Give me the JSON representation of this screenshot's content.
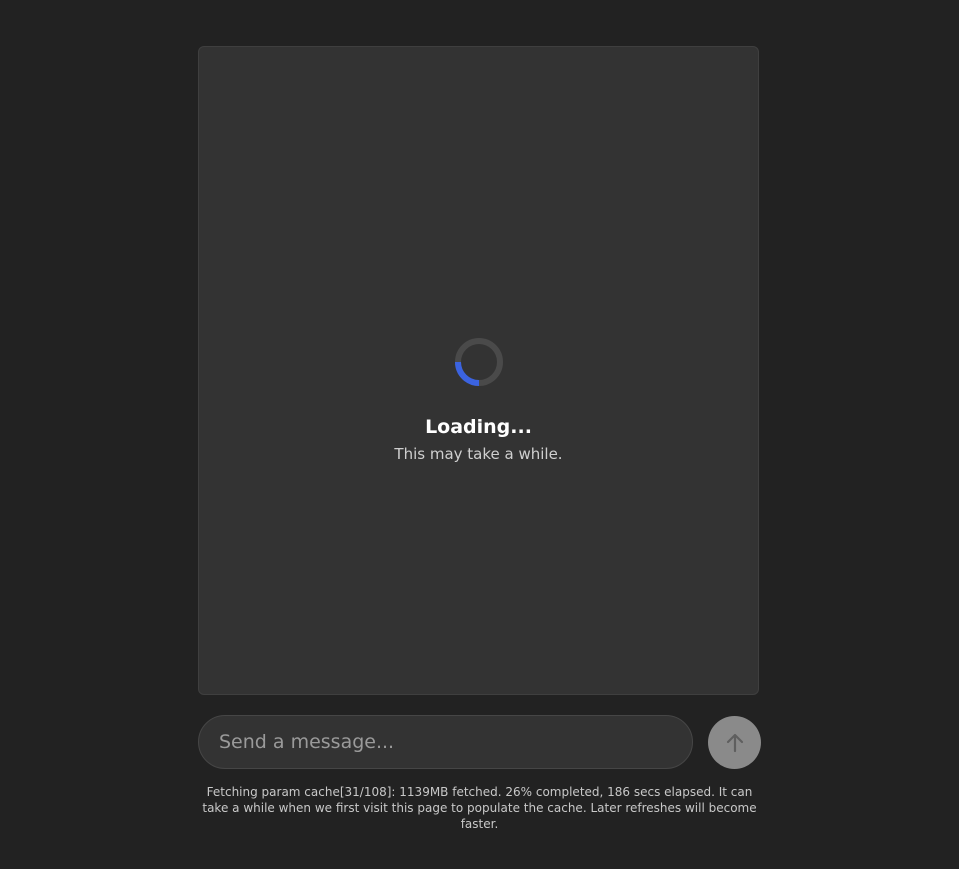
{
  "loading": {
    "title": "Loading...",
    "subtitle": "This may take a while.",
    "spinner_accent": "#3b63e0",
    "spinner_track": "#4a4a4a"
  },
  "composer": {
    "placeholder": "Send a message...",
    "value": "",
    "send_icon": "arrow-up-icon"
  },
  "status": {
    "message": "Fetching param cache[31/108]: 1139MB fetched. 26% completed, 186 secs elapsed. It can take a while when we first visit this page to populate the cache. Later refreshes will become faster.",
    "progress_percent": 26
  },
  "colors": {
    "page_bg": "#222222",
    "panel_bg": "#333333",
    "send_button_bg": "#8a8a8a"
  }
}
